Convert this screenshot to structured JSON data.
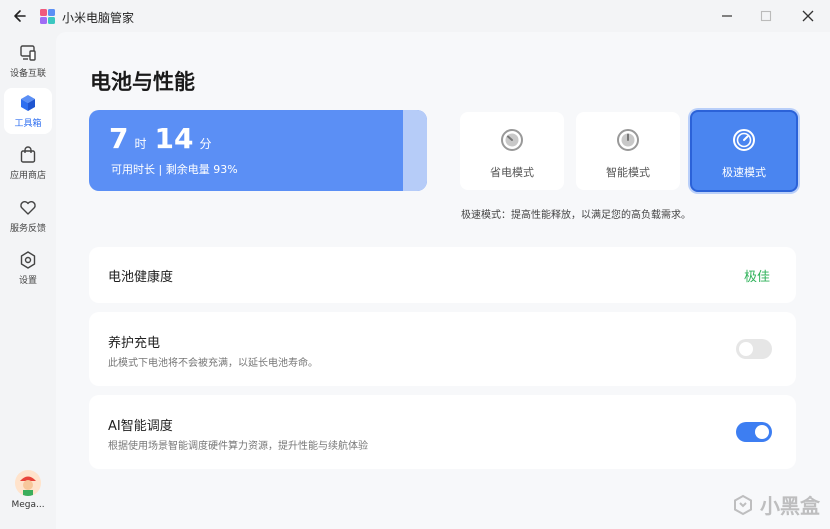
{
  "window": {
    "title": "小米电脑管家",
    "controls": [
      "minimize-icon",
      "maximize-icon",
      "close-icon"
    ]
  },
  "sidebar": {
    "items": [
      {
        "label": "设备互联",
        "icon": "devices-icon"
      },
      {
        "label": "工具箱",
        "icon": "toolbox-cube-icon",
        "active": true
      },
      {
        "label": "应用商店",
        "icon": "shopping-bag-icon"
      },
      {
        "label": "服务反馈",
        "icon": "feedback-heart-icon"
      },
      {
        "label": "设置",
        "icon": "settings-gear-icon"
      }
    ],
    "user": {
      "name": "Mega..."
    }
  },
  "page": {
    "title": "电池与性能"
  },
  "battery": {
    "hours": "7",
    "hours_unit": "时",
    "minutes": "14",
    "minutes_unit": "分",
    "subtitle": "可用时长 | 剩余电量 93%",
    "level_percent": 93
  },
  "modes": {
    "items": [
      {
        "label": "省电模式",
        "icon": "gauge-low-icon"
      },
      {
        "label": "智能模式",
        "icon": "gauge-mid-icon"
      },
      {
        "label": "极速模式",
        "icon": "gauge-high-icon",
        "selected": true
      }
    ],
    "description": "极速模式：提高性能释放，以满足您的高负载需求。"
  },
  "settings": {
    "health": {
      "title": "电池健康度",
      "value": "极佳",
      "value_color": "#2fb25a"
    },
    "care_charge": {
      "title": "养护充电",
      "subtitle": "此模式下电池将不会被充满，以延长电池寿命。",
      "enabled": false
    },
    "ai_schedule": {
      "title": "AI智能调度",
      "subtitle": "根据使用场景智能调度硬件算力资源，提升性能与续航体验",
      "enabled": true
    }
  },
  "watermark": {
    "text": "小黑盒"
  },
  "colors": {
    "accent": "#4a85f0",
    "battery_card": "#5b8ff5",
    "toggle_on": "#3d7ef2"
  }
}
